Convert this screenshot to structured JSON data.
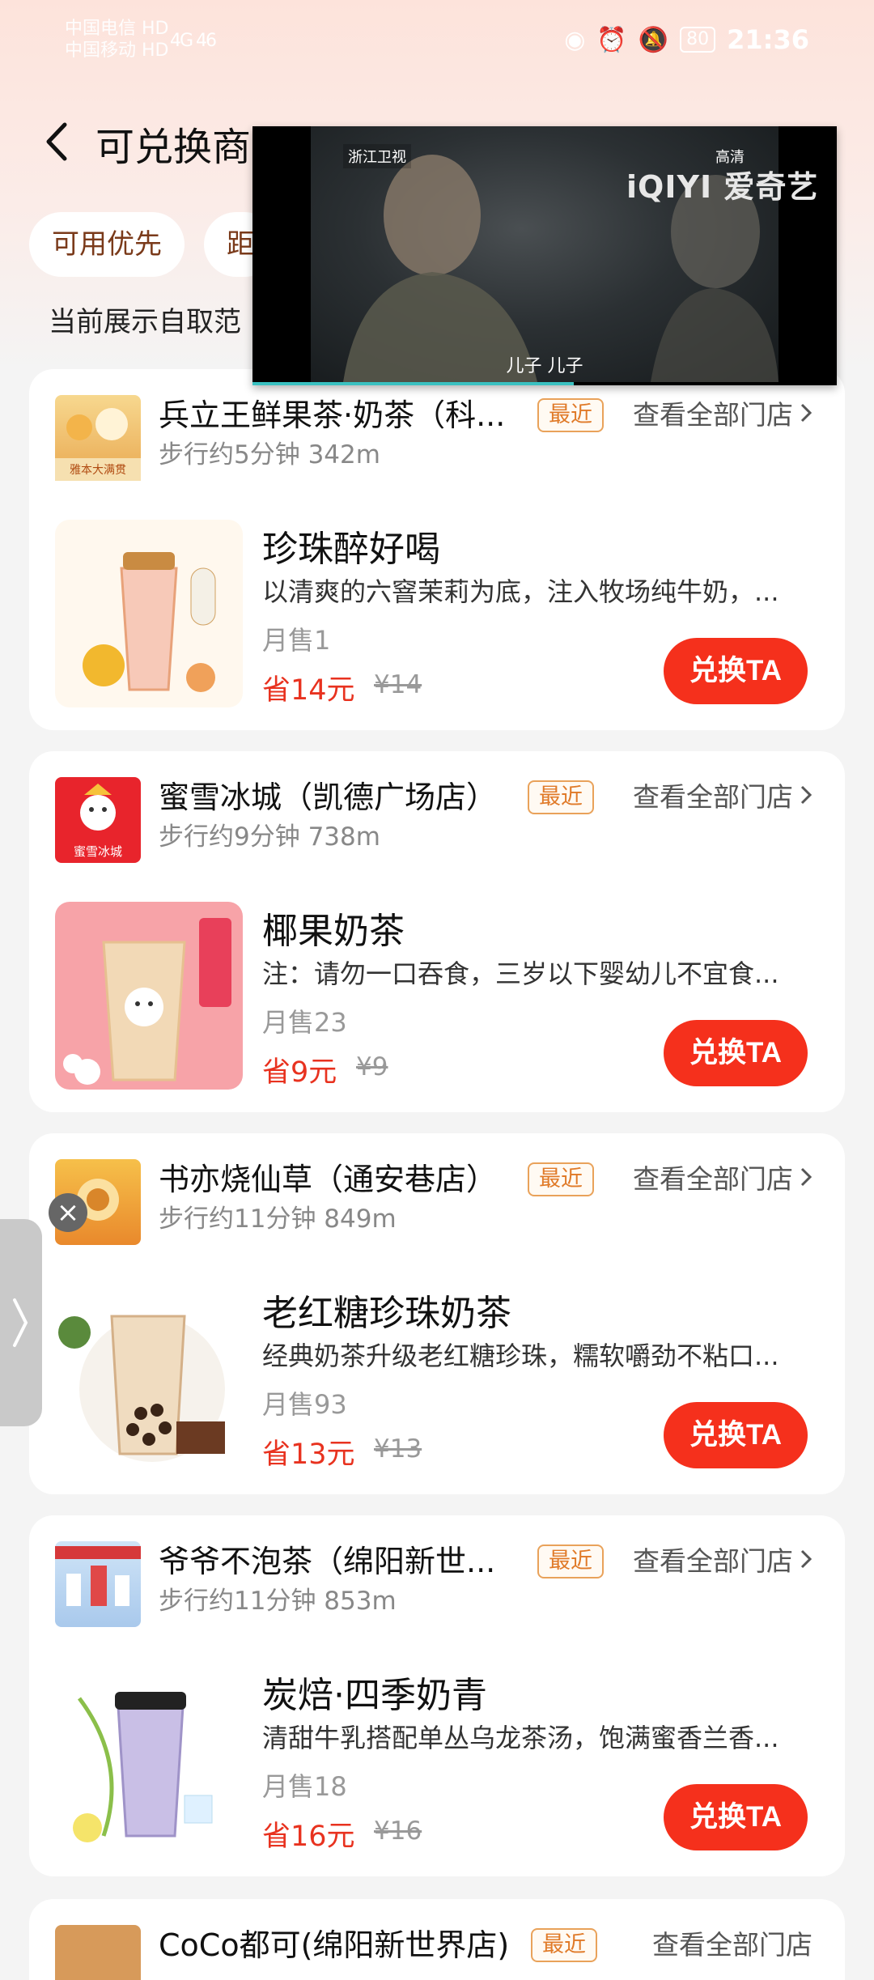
{
  "status_bar": {
    "carrier_line1": "中国电信 HD",
    "carrier_line2": "中国移动 HD",
    "signal_text": "4G 46",
    "battery": "80",
    "time": "21:36"
  },
  "header": {
    "title": "可兑换商品"
  },
  "filters": [
    {
      "label": "可用优先"
    },
    {
      "label": "距"
    }
  ],
  "range_text": "当前展示自取范",
  "video": {
    "channel": "浙江卫视",
    "quality": "高清",
    "brand": "iQIYI 爱奇艺",
    "subtitle": "儿子 儿子",
    "progress": 0.55
  },
  "cards": [
    {
      "shop_name": "兵立王鲜果茶·奶茶（科...",
      "badge": "最近",
      "all_stores": "查看全部门店",
      "distance": "步行约5分钟 342m",
      "product_name": "珍珠醉好喝",
      "product_desc": "以清爽的六窨茉莉为底，注入牧场纯牛奶，...",
      "sales": "月售1",
      "save": "省14元",
      "original_price": "¥14",
      "button": "兑换TA",
      "logo_caption": "雅本大满贯",
      "logo_color": "#f2c266"
    },
    {
      "shop_name": "蜜雪冰城（凯德广场店）",
      "badge": "最近",
      "all_stores": "查看全部门店",
      "distance": "步行约9分钟 738m",
      "product_name": "椰果奶茶",
      "product_desc": "注：请勿一口吞食，三岁以下婴幼儿不宜食...",
      "sales": "月售23",
      "save": "省9元",
      "original_price": "¥9",
      "button": "兑换TA",
      "logo_caption": "蜜雪冰城",
      "logo_color": "#e8242c"
    },
    {
      "shop_name": "书亦烧仙草（通安巷店）",
      "badge": "最近",
      "all_stores": "查看全部门店",
      "distance": "步行约11分钟 849m",
      "product_name": "老红糖珍珠奶茶",
      "product_desc": "经典奶茶升级老红糖珍珠，糯软嚼劲不粘口...",
      "sales": "月售93",
      "save": "省13元",
      "original_price": "¥13",
      "button": "兑换TA",
      "logo_caption": "",
      "logo_color": "#f0a030"
    },
    {
      "shop_name": "爷爷不泡茶（绵阳新世...",
      "badge": "最近",
      "all_stores": "查看全部门店",
      "distance": "步行约11分钟 853m",
      "product_name": "炭焙·四季奶青",
      "product_desc": "清甜牛乳搭配单丛乌龙茶汤，饱满蜜香兰香...",
      "sales": "月售18",
      "save": "省16元",
      "original_price": "¥16",
      "button": "兑换TA",
      "logo_caption": "",
      "logo_color": "#8fb6e0"
    }
  ],
  "partial_card": {
    "shop_name": "CoCo都可(绵阳新世界店)",
    "badge": "最近",
    "all_stores": "查看全部门店"
  }
}
